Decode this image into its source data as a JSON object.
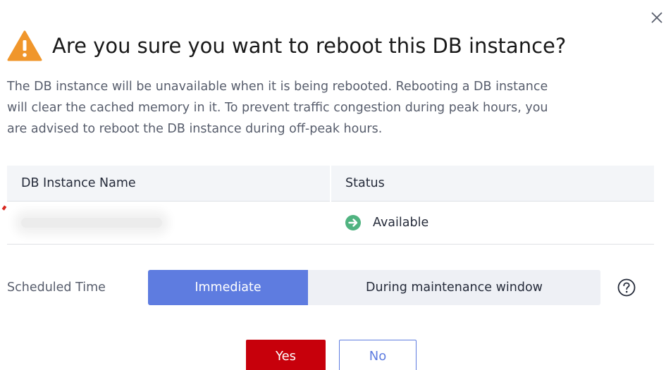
{
  "dialog": {
    "close_symbol": "×",
    "title": "Are you sure you want to reboot this DB instance?",
    "description_lines": [
      "The DB instance will be unavailable when it is being rebooted. Rebooting a DB instance",
      "will clear the cached memory in it. To prevent traffic congestion during peak hours, you",
      "are advised to reboot the DB instance during off-peak hours."
    ],
    "icons": {
      "title": "warning-icon",
      "status": "arrow-right-circle-icon",
      "help": "question-circle-icon",
      "close": "close-icon"
    }
  },
  "table": {
    "columns": [
      "DB Instance Name",
      "Status"
    ],
    "rows": [
      {
        "name": "",
        "status": "Available"
      }
    ]
  },
  "schedule": {
    "label": "Scheduled Time",
    "options": [
      "Immediate",
      "During maintenance window"
    ],
    "selected": "Immediate"
  },
  "buttons": {
    "yes": "Yes",
    "no": "No"
  },
  "colors": {
    "warning": "#f0962b",
    "status_ok": "#50b380",
    "accent": "#5e7ce0",
    "danger": "#c7000b"
  }
}
